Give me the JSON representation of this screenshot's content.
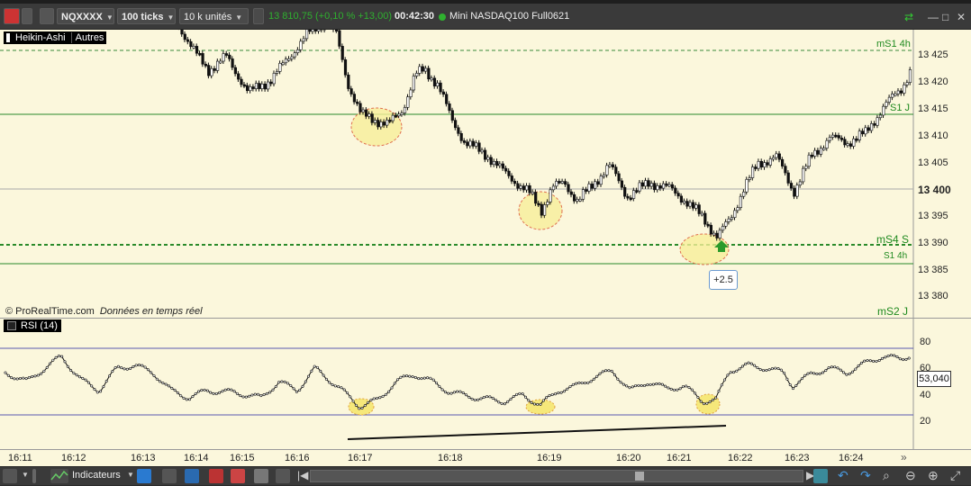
{
  "toolbar": {
    "instrument": "NQXXXX",
    "interval": "100 ticks",
    "units": "10 k unités",
    "price_change": "13 810,75 (+0,10 % +13,00)",
    "time": "00:42:30",
    "product": "Mini NASDAQ100 Full0621"
  },
  "chart": {
    "chart_type_label": "Heikin-Ashi",
    "others_label": "Autres",
    "watermark": "© ProRealTime.com",
    "realtime": "Données en temps réel",
    "badge_value": "+2.5"
  },
  "price_axis": {
    "ticks": [
      "13 425",
      "13 420",
      "13 415",
      "13 410",
      "13 405",
      "13 400",
      "13 395",
      "13 390",
      "13 385",
      "13 380"
    ]
  },
  "levels": {
    "ms1_4h": "mS1 4h",
    "s1_j": "S1 J",
    "ms4_s": "mS4 S",
    "s1_4h": "S1 4h",
    "ms2_j": "mS2 J"
  },
  "rsi": {
    "label": "RSI (14)",
    "ticks": [
      "80",
      "60",
      "40",
      "20"
    ],
    "current_value": "53,040"
  },
  "time_axis": {
    "ticks": [
      "16:11",
      "16:12",
      "16:13",
      "16:14",
      "16:15",
      "16:16",
      "16:17",
      "16:18",
      "16:19",
      "16:20",
      "16:21",
      "16:22",
      "16:23",
      "16:24"
    ]
  },
  "bottom": {
    "indicators_label": "Indicateurs"
  }
}
